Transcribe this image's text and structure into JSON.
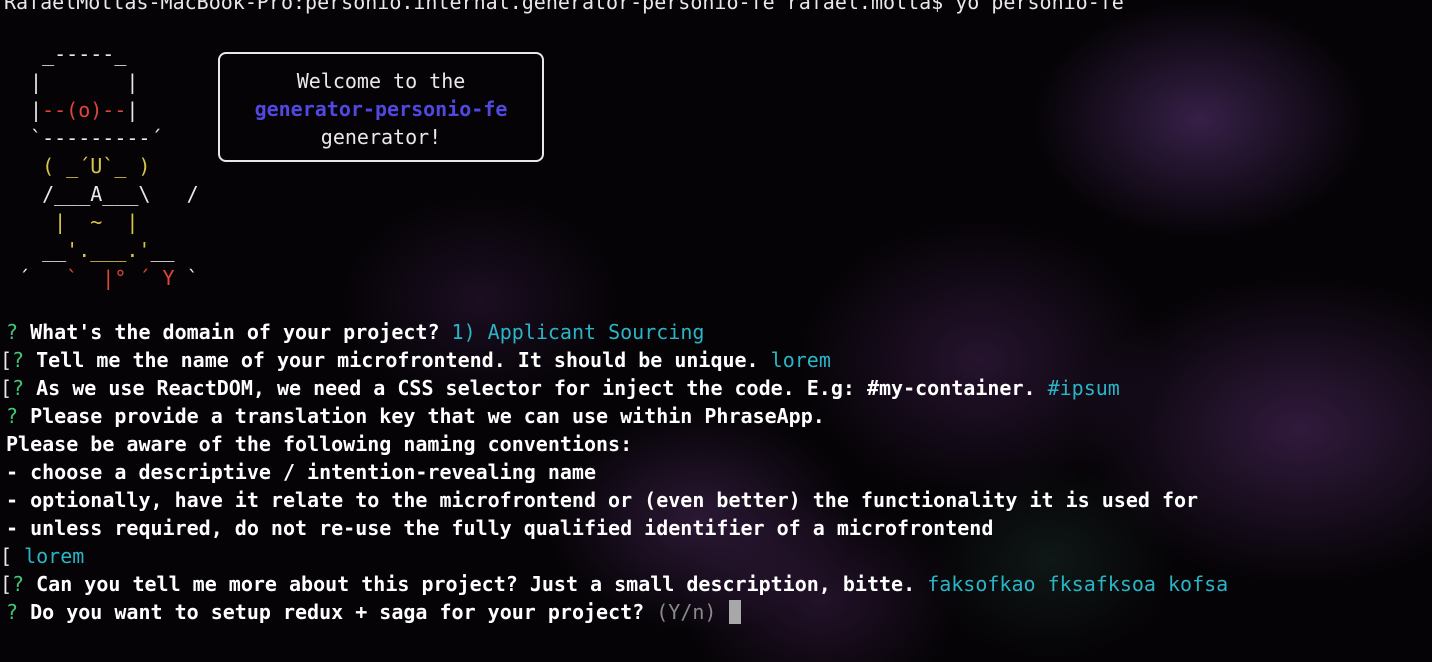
{
  "shell_prompt": "RafaelMottas-MacBook-Pro:personio.internal.generator-personio-fe rafael.motta$ yo personio-fe",
  "yeoman_art": {
    "line1": "  _-----_",
    "line2": " |       |",
    "line3_left": " |",
    "line3_mid": "--(o)--",
    "line3_right": "|",
    "line4": " `---------´",
    "line5_left": "  ",
    "line5_mid": "( _´U`_ )",
    "line6": "  /___A___\\   /",
    "line7_left": "   ",
    "line7_mid": "|  ~  |",
    "line8_left": "  __",
    "line8_mid": "'.___.'",
    "line8_right": "__",
    "line9_a": "´   ",
    "line9_b": "`  ",
    "line9_c": "|° ",
    "line9_d": "´ Y ",
    "line9_e": "`"
  },
  "welcome_box": {
    "line1": "Welcome to the",
    "line2": "generator-personio-fe",
    "line3": "generator!"
  },
  "questions": [
    {
      "mark": "?",
      "bracket": "",
      "text": "What's the domain of your project?",
      "answer": "1) Applicant Sourcing"
    },
    {
      "mark": "?",
      "bracket": "[",
      "text": "Tell me the name of your microfrontend. It should be unique.",
      "answer": "lorem"
    },
    {
      "mark": "?",
      "bracket": "[",
      "text": "As we use ReactDOM, we need a CSS selector for inject the code. E.g: #my-container.",
      "answer": "#ipsum"
    },
    {
      "mark": "?",
      "bracket": "",
      "text": "Please provide a translation key that we can use within PhraseApp.",
      "answer": ""
    }
  ],
  "conventions": {
    "intro": "Please be aware of the following naming conventions:",
    "items": [
      "- choose a descriptive / intention-revealing name",
      "- optionally, have it relate to the microfrontend or (even better) the functionality it is used for",
      "- unless required, do not re-use the fully qualified identifier of a microfrontend"
    ],
    "answer_bracket": "[",
    "answer": "lorem"
  },
  "description_question": {
    "mark": "?",
    "bracket": "[",
    "text": "Can you tell me more about this project? Just a small description, bitte.",
    "answer": "faksofkao fksafksoa kofsa"
  },
  "active_question": {
    "mark": "?",
    "text": "Do you want to setup redux + saga for your project?",
    "hint": "(Y/n)"
  },
  "colors": {
    "question_mark": "#3ec977",
    "answer": "#2ab5c7",
    "hint": "#8a8a8a",
    "generator_name": "#5048e0",
    "yeoman_eye": "#e0453a",
    "yeoman_face": "#d8c64a"
  }
}
